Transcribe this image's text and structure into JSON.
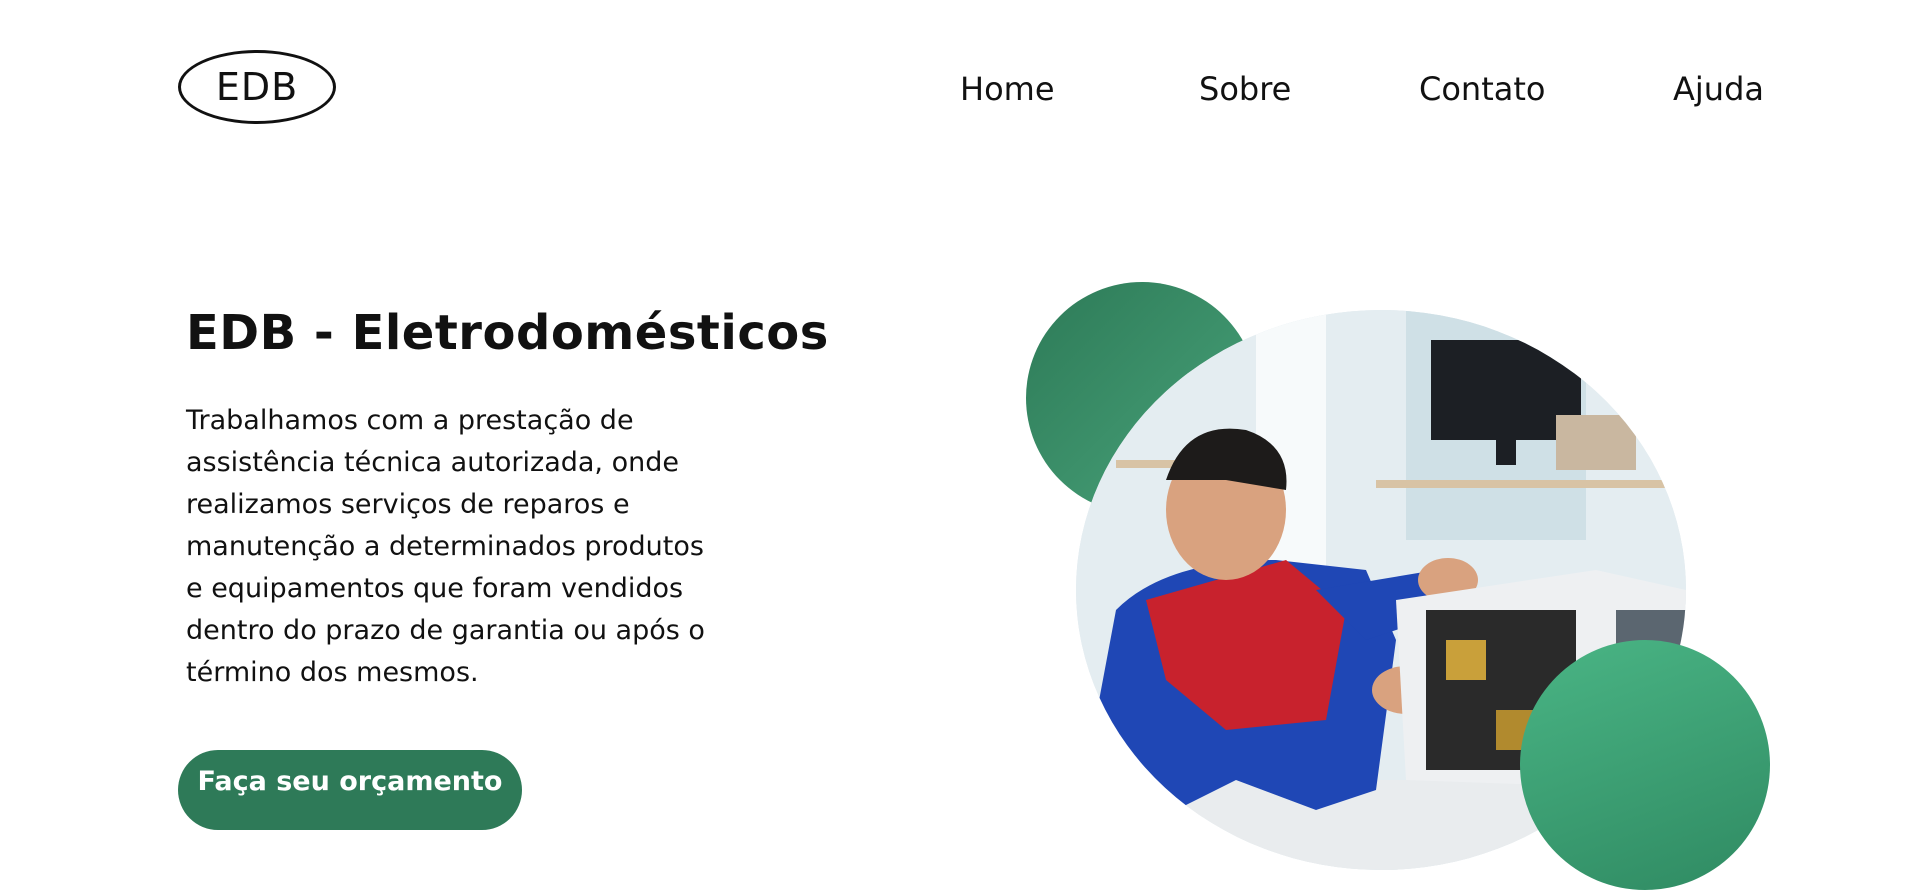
{
  "header": {
    "logo_text": "EDB",
    "nav": [
      "Home",
      "Sobre",
      "Contato",
      "Ajuda"
    ]
  },
  "hero": {
    "title": "EDB - Eletrodomésticos",
    "description": "Trabalhamos com a prestação de assistência técnica autorizada, onde realizamos serviços de reparos e manutenção a determinados produtos e equipamentos que foram vendidos dentro do prazo de garantia ou após o término dos mesmos.",
    "cta_label": "Faça seu orçamento"
  },
  "colors": {
    "accent": "#2e7a58",
    "accent_light": "#4aa57c"
  }
}
